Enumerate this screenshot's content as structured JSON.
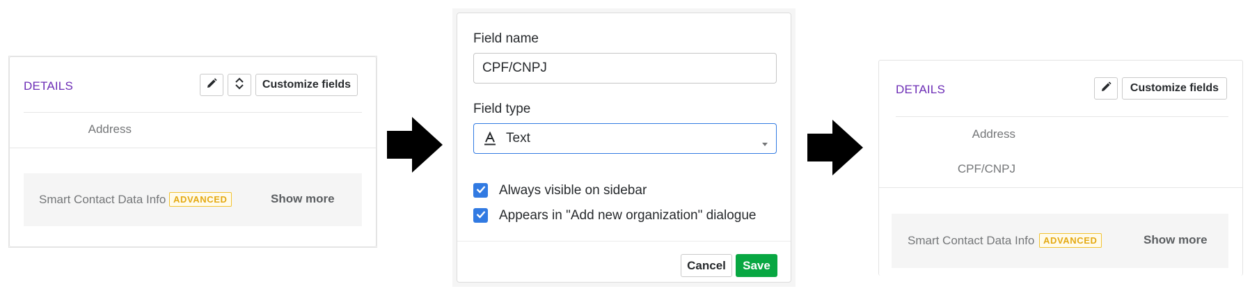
{
  "before_panel": {
    "title": "DETAILS",
    "customize_label": "Customize fields",
    "fields": [
      "Address"
    ],
    "smart_label": "Smart Contact Data Info",
    "badge": "ADVANCED",
    "show_more": "Show more"
  },
  "dialog": {
    "field_name_label": "Field name",
    "field_name_value": "CPF/CNPJ",
    "field_type_label": "Field type",
    "field_type_value": "Text",
    "option_sidebar": "Always visible on sidebar",
    "option_dialogue": "Appears in \"Add new organization\" dialogue",
    "cancel": "Cancel",
    "save": "Save"
  },
  "after_panel": {
    "title": "DETAILS",
    "customize_label": "Customize fields",
    "fields": [
      "Address",
      "CPF/CNPJ"
    ],
    "smart_label": "Smart Contact Data Info",
    "badge": "ADVANCED",
    "show_more": "Show more"
  },
  "colors": {
    "accent_purple": "#6b2bb5",
    "save_green": "#08a742",
    "focus_blue": "#317ae2",
    "badge_yellow": "#f2c230"
  },
  "icons": [
    "pencil-icon",
    "sort-arrows-icon",
    "text-type-icon",
    "caret-down-icon",
    "check-icon",
    "right-arrow-icon"
  ]
}
